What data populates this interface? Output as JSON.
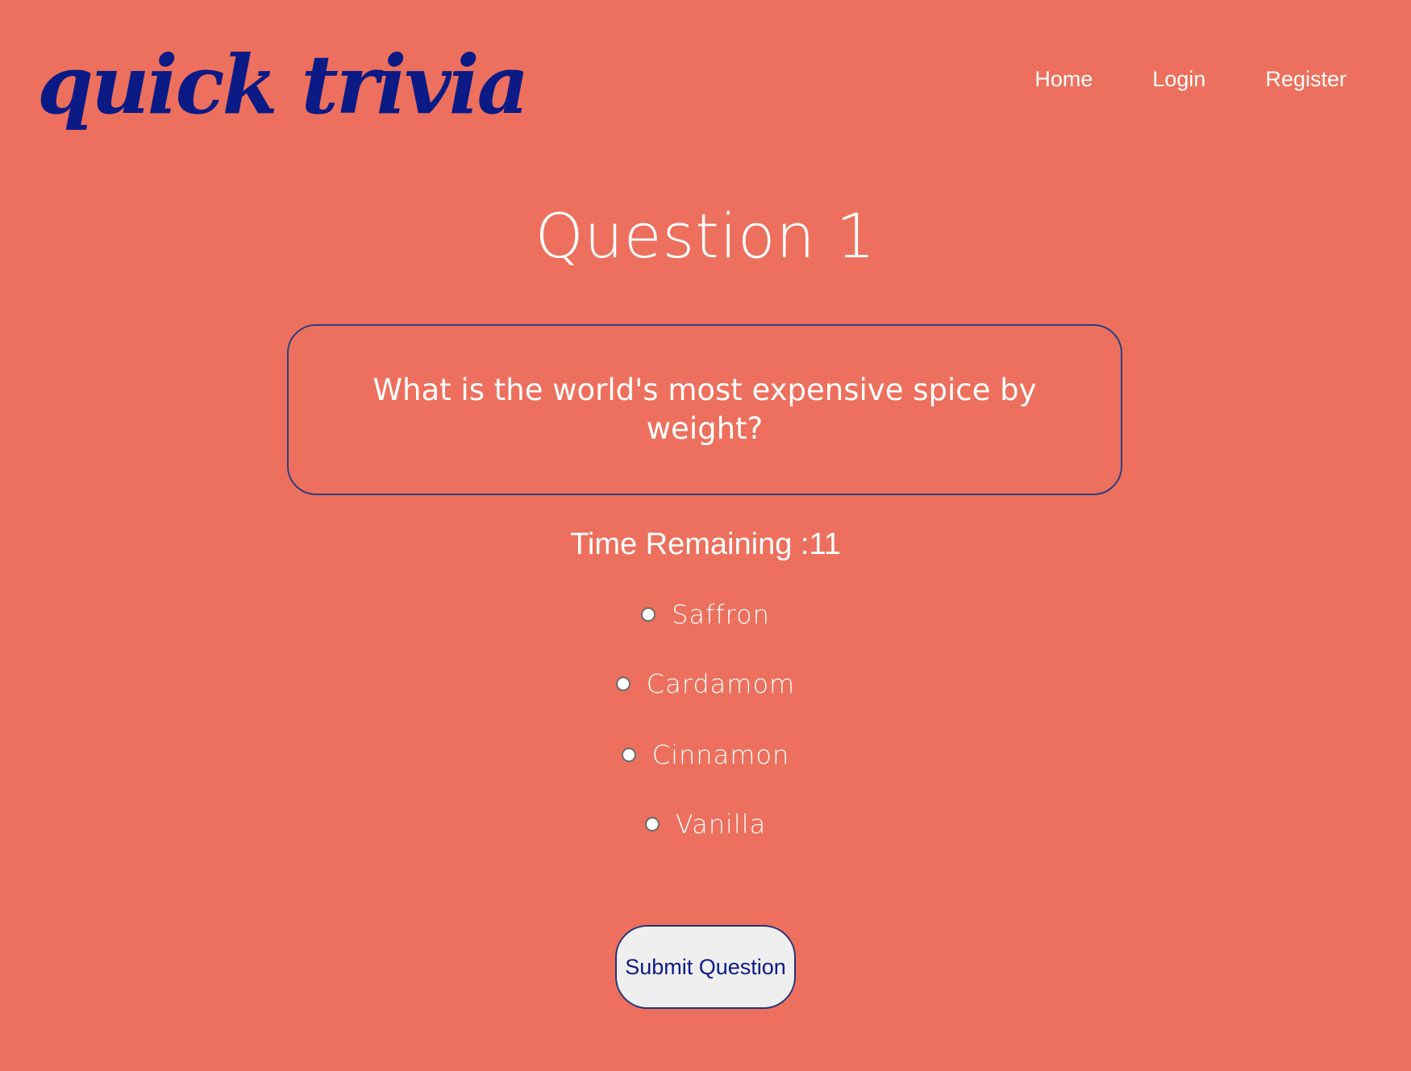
{
  "header": {
    "logo_text": "quick trivia",
    "nav": [
      {
        "label": "Home"
      },
      {
        "label": "Login"
      },
      {
        "label": "Register"
      }
    ]
  },
  "quiz": {
    "question_title": "Question 1",
    "question_text": "What is the world's most expensive spice by weight?",
    "timer_text": "Time Remaining :11",
    "answers": [
      {
        "label": "Saffron",
        "selected": false
      },
      {
        "label": "Cardamom",
        "selected": false
      },
      {
        "label": "Cinnamon",
        "selected": false
      },
      {
        "label": "Vanilla",
        "selected": false
      }
    ],
    "submit_label": "Submit Question"
  },
  "colors": {
    "background": "#ec705d",
    "logo": "#0c1a86",
    "question_border": "#2b3e7e",
    "button_background": "#efefef",
    "button_text": "#0c1a86"
  }
}
